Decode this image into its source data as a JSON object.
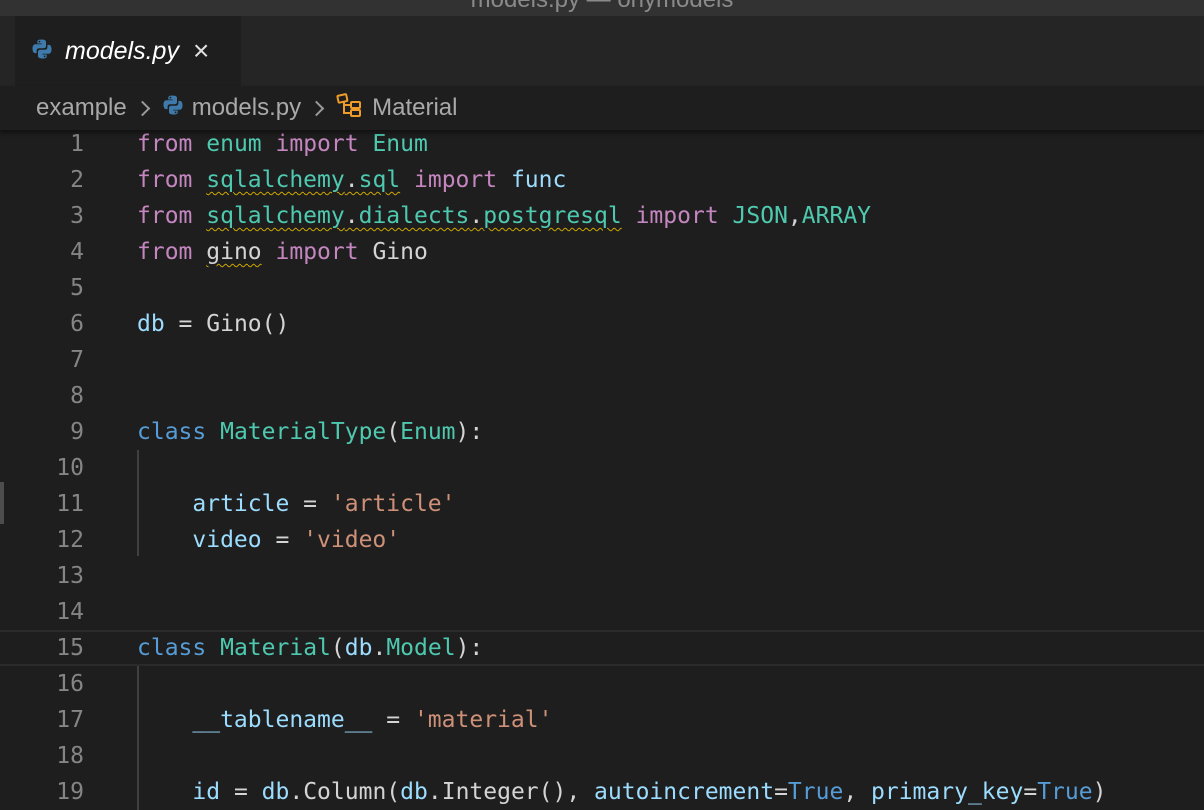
{
  "window": {
    "title": "models.py — onymodels"
  },
  "tab": {
    "label": "models.py",
    "close": "×"
  },
  "breadcrumb": {
    "folder": "example",
    "file": "models.py",
    "symbol": "Material"
  },
  "colors": {
    "keyword": "#c586c0",
    "module": "#4ec9b0",
    "variable": "#9cdcfe",
    "string": "#ce9178",
    "constant": "#569cd6",
    "warning": "#cca700",
    "python": "#3e7aab"
  },
  "lines": [
    {
      "n": "1",
      "tokens": [
        {
          "t": "from",
          "c": "kw"
        },
        {
          "t": " ",
          "c": "plain"
        },
        {
          "t": "enum",
          "c": "mod"
        },
        {
          "t": " ",
          "c": "plain"
        },
        {
          "t": "import",
          "c": "kw"
        },
        {
          "t": " ",
          "c": "plain"
        },
        {
          "t": "Enum",
          "c": "mod"
        }
      ]
    },
    {
      "n": "2",
      "tokens": [
        {
          "t": "from",
          "c": "kw"
        },
        {
          "t": " ",
          "c": "plain"
        },
        {
          "t": "sqlalchemy",
          "c": "mod squig"
        },
        {
          "t": ".",
          "c": "plain squig"
        },
        {
          "t": "sql",
          "c": "mod squig"
        },
        {
          "t": " ",
          "c": "plain"
        },
        {
          "t": "import",
          "c": "kw"
        },
        {
          "t": " ",
          "c": "plain"
        },
        {
          "t": "func",
          "c": "var"
        }
      ]
    },
    {
      "n": "3",
      "tokens": [
        {
          "t": "from",
          "c": "kw"
        },
        {
          "t": " ",
          "c": "plain"
        },
        {
          "t": "sqlalchemy",
          "c": "mod squig"
        },
        {
          "t": ".",
          "c": "plain squig"
        },
        {
          "t": "dialects",
          "c": "mod squig"
        },
        {
          "t": ".",
          "c": "plain squig"
        },
        {
          "t": "postgresql",
          "c": "mod squig"
        },
        {
          "t": " ",
          "c": "plain"
        },
        {
          "t": "import",
          "c": "kw"
        },
        {
          "t": " ",
          "c": "plain"
        },
        {
          "t": "JSON",
          "c": "mod"
        },
        {
          "t": ",",
          "c": "plain"
        },
        {
          "t": "ARRAY",
          "c": "mod"
        }
      ]
    },
    {
      "n": "4",
      "tokens": [
        {
          "t": "from",
          "c": "kw"
        },
        {
          "t": " ",
          "c": "plain"
        },
        {
          "t": "gino",
          "c": "plain squig"
        },
        {
          "t": " ",
          "c": "plain"
        },
        {
          "t": "import",
          "c": "kw"
        },
        {
          "t": " ",
          "c": "plain"
        },
        {
          "t": "Gino",
          "c": "plain"
        }
      ]
    },
    {
      "n": "5",
      "tokens": []
    },
    {
      "n": "6",
      "tokens": [
        {
          "t": "db",
          "c": "var"
        },
        {
          "t": " = ",
          "c": "plain"
        },
        {
          "t": "Gino",
          "c": "plain"
        },
        {
          "t": "()",
          "c": "plain"
        }
      ]
    },
    {
      "n": "7",
      "tokens": []
    },
    {
      "n": "8",
      "tokens": []
    },
    {
      "n": "9",
      "tokens": [
        {
          "t": "class",
          "c": "kw2"
        },
        {
          "t": " ",
          "c": "plain"
        },
        {
          "t": "MaterialType",
          "c": "cls"
        },
        {
          "t": "(",
          "c": "plain"
        },
        {
          "t": "Enum",
          "c": "cls"
        },
        {
          "t": "):",
          "c": "plain"
        }
      ]
    },
    {
      "n": "10",
      "tokens": []
    },
    {
      "n": "11",
      "tokens": [
        {
          "t": "    ",
          "c": "plain"
        },
        {
          "t": "article",
          "c": "var"
        },
        {
          "t": " = ",
          "c": "plain"
        },
        {
          "t": "'article'",
          "c": "str"
        }
      ]
    },
    {
      "n": "12",
      "tokens": [
        {
          "t": "    ",
          "c": "plain"
        },
        {
          "t": "video",
          "c": "var"
        },
        {
          "t": " = ",
          "c": "plain"
        },
        {
          "t": "'video'",
          "c": "str"
        }
      ]
    },
    {
      "n": "13",
      "tokens": []
    },
    {
      "n": "14",
      "tokens": []
    },
    {
      "n": "15",
      "current": true,
      "tokens": [
        {
          "t": "class",
          "c": "kw2"
        },
        {
          "t": " ",
          "c": "plain"
        },
        {
          "t": "Material",
          "c": "cls"
        },
        {
          "t": "(",
          "c": "plain"
        },
        {
          "t": "db",
          "c": "var"
        },
        {
          "t": ".",
          "c": "plain"
        },
        {
          "t": "Model",
          "c": "cls"
        },
        {
          "t": "):",
          "c": "plain"
        }
      ]
    },
    {
      "n": "16",
      "tokens": []
    },
    {
      "n": "17",
      "tokens": [
        {
          "t": "    ",
          "c": "plain"
        },
        {
          "t": "__tablename__",
          "c": "var"
        },
        {
          "t": " = ",
          "c": "plain"
        },
        {
          "t": "'material'",
          "c": "str"
        }
      ]
    },
    {
      "n": "18",
      "tokens": []
    },
    {
      "n": "19",
      "tokens": [
        {
          "t": "    ",
          "c": "plain"
        },
        {
          "t": "id",
          "c": "var"
        },
        {
          "t": " = ",
          "c": "plain"
        },
        {
          "t": "db",
          "c": "var"
        },
        {
          "t": ".",
          "c": "plain"
        },
        {
          "t": "Column",
          "c": "plain"
        },
        {
          "t": "(",
          "c": "plain"
        },
        {
          "t": "db",
          "c": "var"
        },
        {
          "t": ".",
          "c": "plain"
        },
        {
          "t": "Integer",
          "c": "plain"
        },
        {
          "t": "(), ",
          "c": "plain"
        },
        {
          "t": "autoincrement",
          "c": "var"
        },
        {
          "t": "=",
          "c": "plain"
        },
        {
          "t": "True",
          "c": "const"
        },
        {
          "t": ", ",
          "c": "plain"
        },
        {
          "t": "primary_key",
          "c": "var"
        },
        {
          "t": "=",
          "c": "plain"
        },
        {
          "t": "True",
          "c": "const"
        },
        {
          "t": ")",
          "c": "plain"
        }
      ]
    }
  ]
}
